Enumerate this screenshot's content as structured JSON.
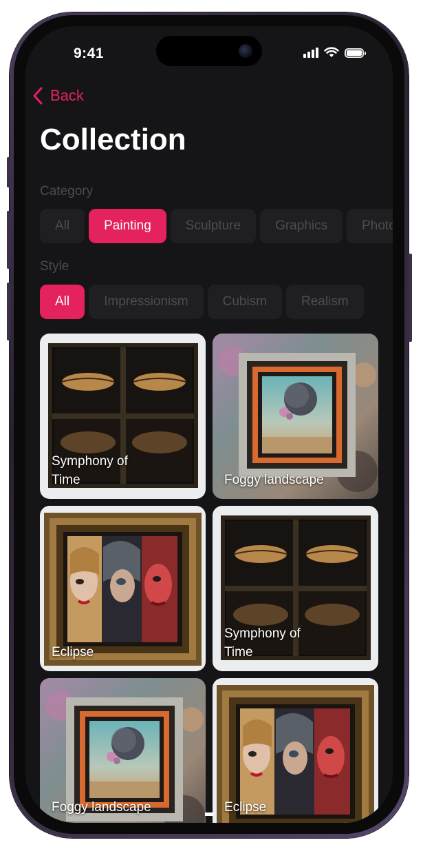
{
  "status_bar": {
    "time": "9:41"
  },
  "nav": {
    "back_label": "Back"
  },
  "page": {
    "title": "Collection"
  },
  "category": {
    "label": "Category",
    "chips": [
      "All",
      "Painting",
      "Sculpture",
      "Graphics",
      "Photo"
    ],
    "selected": "Painting"
  },
  "style": {
    "label": "Style",
    "chips": [
      "All",
      "Impressionism",
      "Cubism",
      "Realism"
    ],
    "selected": "All"
  },
  "artworks": [
    {
      "title": "Symphony of Time",
      "art": "lips-panel"
    },
    {
      "title": "Foggy landscape",
      "art": "moon-frame"
    },
    {
      "title": "Eclipse",
      "art": "masked-faces"
    },
    {
      "title": "Symphony of Time",
      "art": "lips-panel"
    },
    {
      "title": "Foggy landscape",
      "art": "moon-frame"
    },
    {
      "title": "Eclipse",
      "art": "masked-faces"
    }
  ],
  "colors": {
    "accent": "#e3225e",
    "background": "#151517",
    "chip_inactive": "#1f1f22",
    "chip_text_inactive": "#4c4c52",
    "section_label": "#4a4a50"
  }
}
